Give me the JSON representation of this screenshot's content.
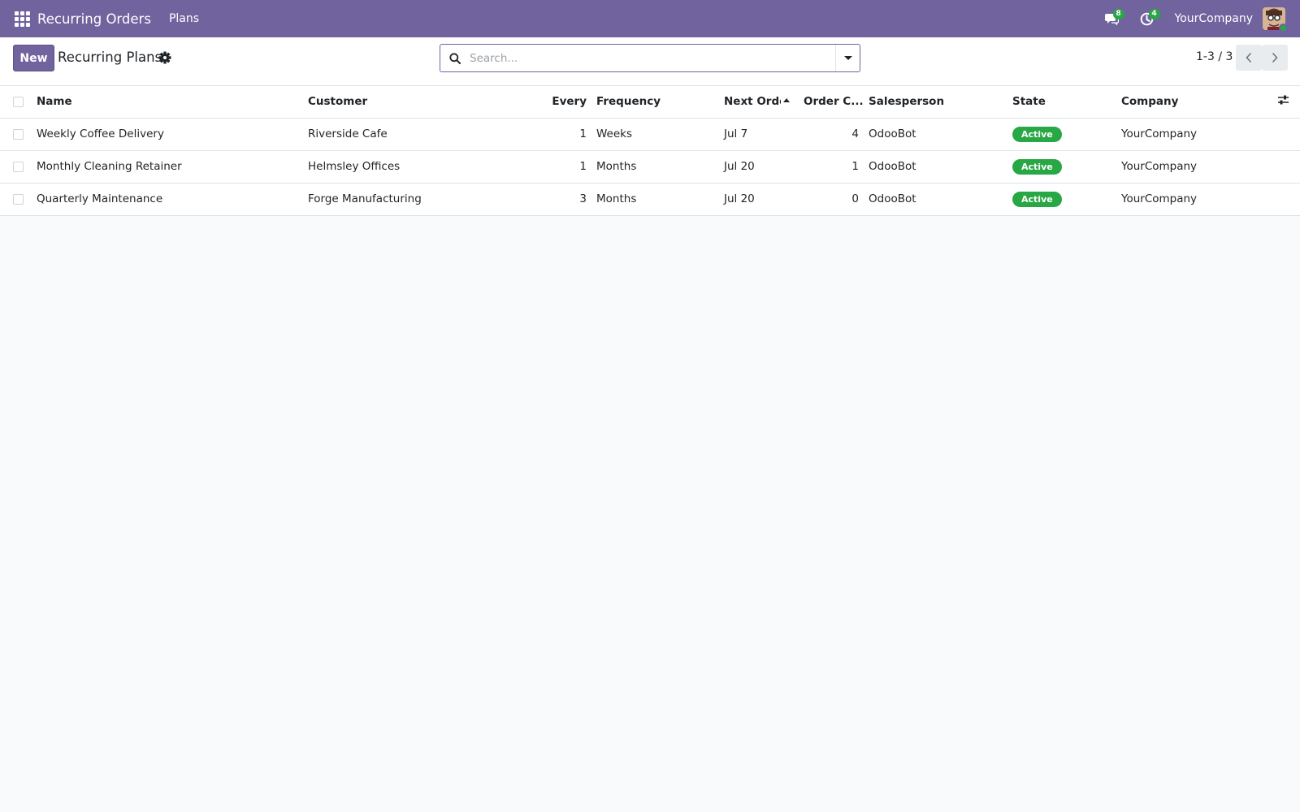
{
  "navbar": {
    "brand": "Recurring Orders",
    "menu_plans": "Plans",
    "messages_count": "8",
    "activities_count": "4",
    "company": "YourCompany",
    "bg_color": "#71639e"
  },
  "control_panel": {
    "new_label": "New",
    "breadcrumb": "Recurring Plans",
    "search_placeholder": "Search...",
    "pager_value": "1-3 / 3"
  },
  "table": {
    "headers": {
      "name": "Name",
      "customer": "Customer",
      "every": "Every",
      "frequency": "Frequency",
      "next_order": "Next Order",
      "order_count": "Order C...",
      "salesperson": "Salesperson",
      "state": "State",
      "company": "Company"
    },
    "rows": [
      {
        "name": "Weekly Coffee Delivery",
        "customer": "Riverside Cafe",
        "every": "1",
        "frequency": "Weeks",
        "next_order": "Jul 7",
        "order_count": "4",
        "salesperson": "OdooBot",
        "state": "Active",
        "company": "YourCompany"
      },
      {
        "name": "Monthly Cleaning Retainer",
        "customer": "Helmsley Offices",
        "every": "1",
        "frequency": "Months",
        "next_order": "Jul 20",
        "order_count": "1",
        "salesperson": "OdooBot",
        "state": "Active",
        "company": "YourCompany"
      },
      {
        "name": "Quarterly Maintenance",
        "customer": "Forge Manufacturing",
        "every": "3",
        "frequency": "Months",
        "next_order": "Jul 20",
        "order_count": "0",
        "salesperson": "OdooBot",
        "state": "Active",
        "company": "YourCompany"
      }
    ]
  },
  "colors": {
    "accent": "#71639e",
    "status_active": "#28a745"
  }
}
